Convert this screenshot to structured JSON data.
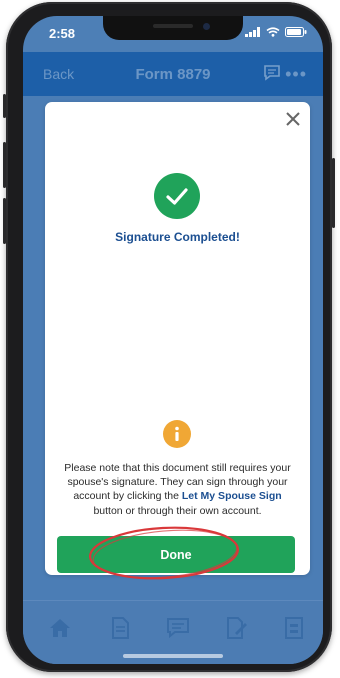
{
  "status_bar": {
    "time": "2:58"
  },
  "header": {
    "back_label": "Back",
    "title": "Form 8879"
  },
  "modal": {
    "title": "Signature Completed!",
    "note_before": "Please note that this document still requires your spouse's signature. They can sign through your account by clicking the ",
    "note_link": "Let My Spouse Sign",
    "note_after": " button or through their own account.",
    "done_label": "Done"
  },
  "tabbar": {
    "items": [
      "home-icon",
      "document-icon",
      "chat-icon",
      "sign-icon",
      "forms-icon"
    ]
  },
  "colors": {
    "header": "#1d5fa8",
    "accent_green": "#20a35a",
    "link_blue": "#1c4f91",
    "info_orange": "#f0a735",
    "annotation_red": "#d9383a"
  }
}
